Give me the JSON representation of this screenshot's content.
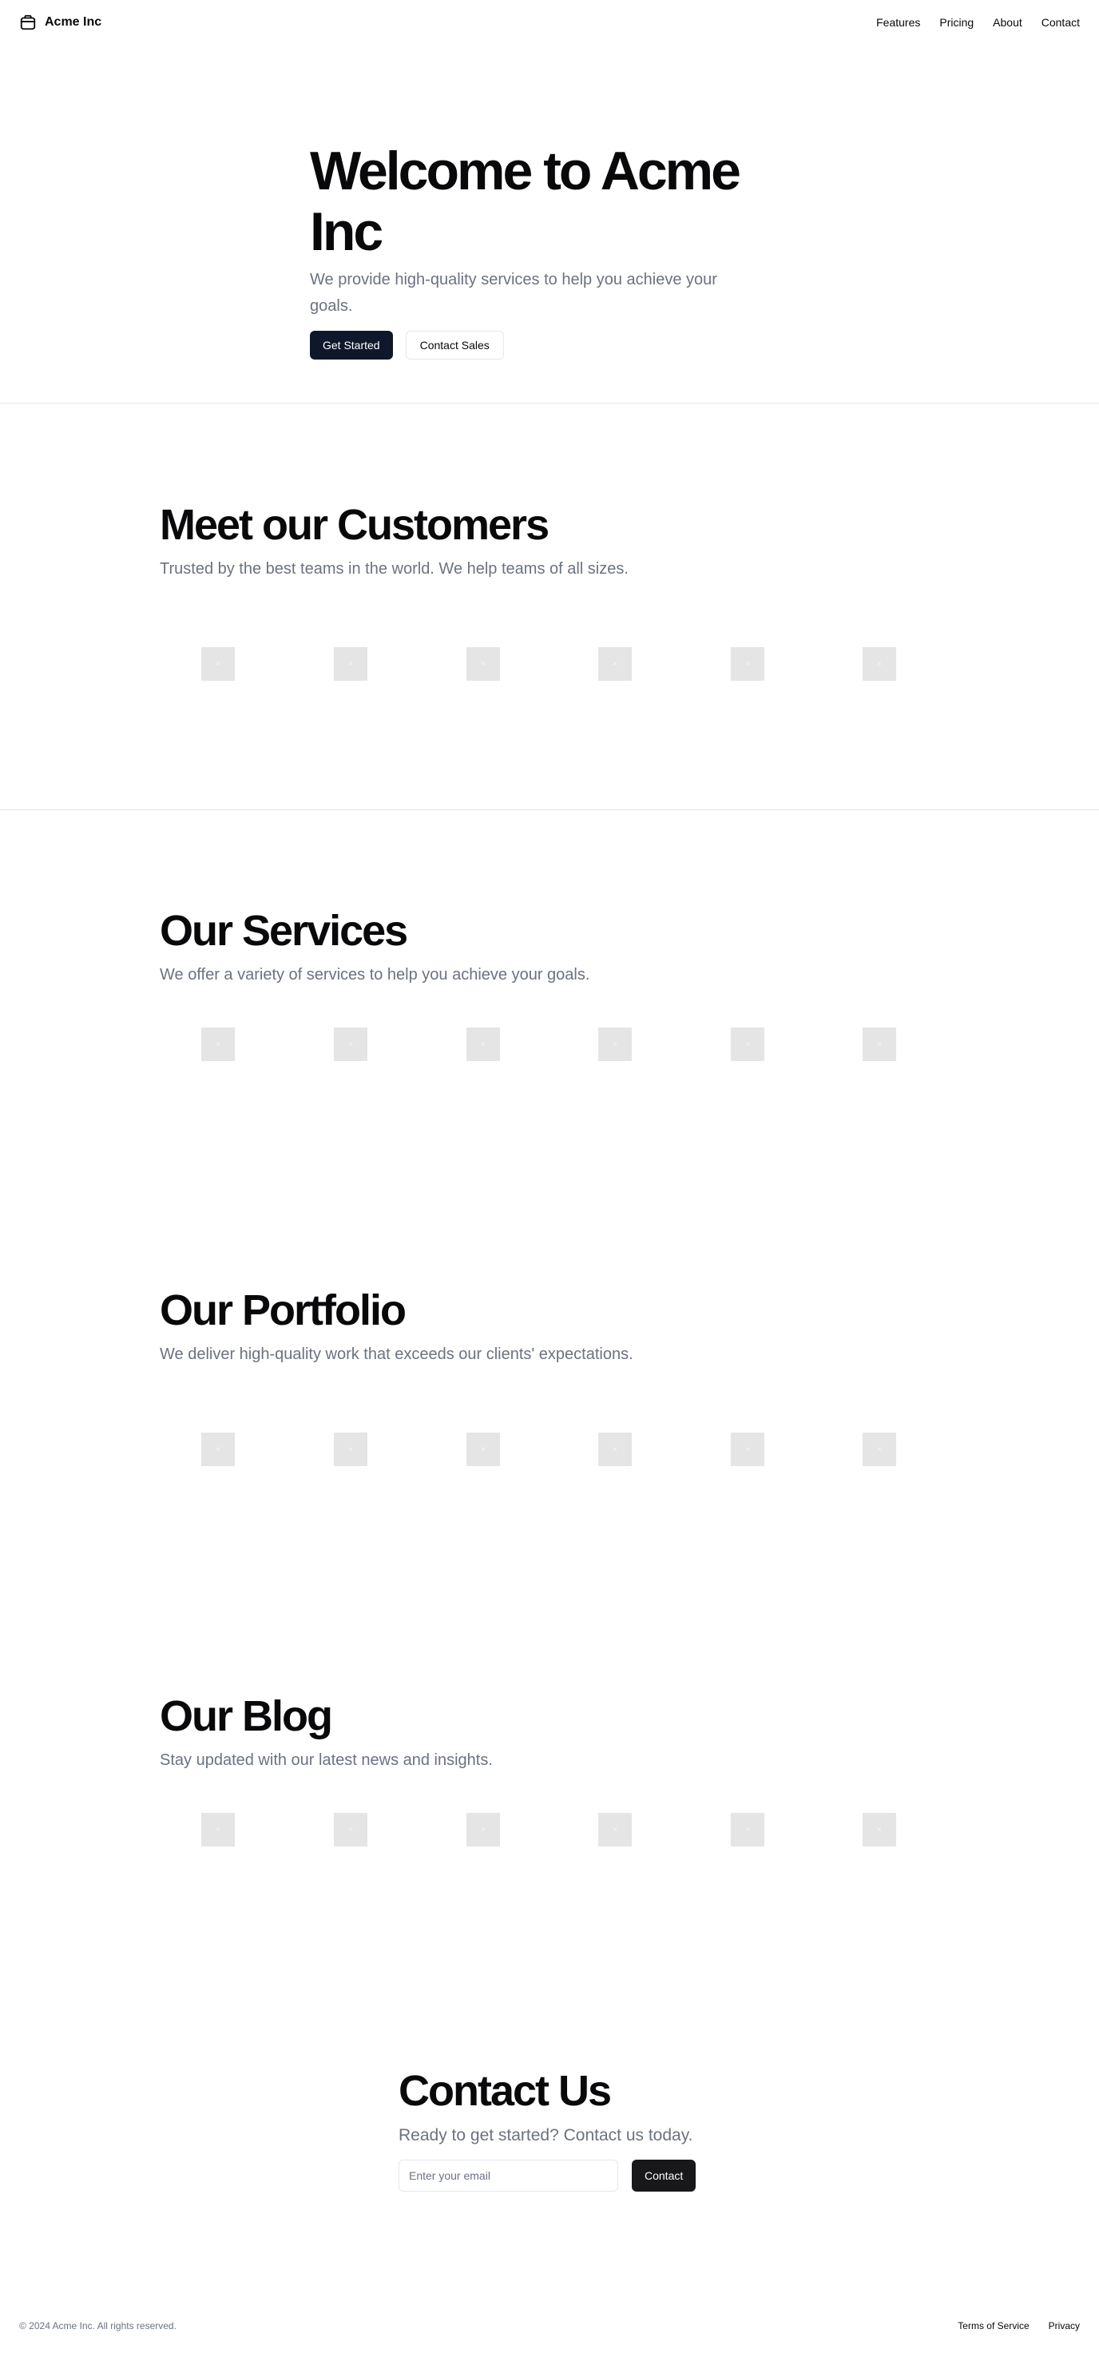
{
  "header": {
    "brand": "Acme Inc",
    "nav": [
      "Features",
      "Pricing",
      "About",
      "Contact"
    ]
  },
  "hero": {
    "title": "Welcome to Acme Inc",
    "subtitle": "We provide high-quality services to help you achieve your goals.",
    "primary_button": "Get Started",
    "secondary_button": "Contact Sales"
  },
  "sections": [
    {
      "title": "Meet our Customers",
      "subtitle": "Trusted by the best teams in the world. We help teams of all sizes."
    },
    {
      "title": "Our Services",
      "subtitle": "We offer a variety of services to help you achieve your goals."
    },
    {
      "title": "Our Portfolio",
      "subtitle": "We deliver high-quality work that exceeds our clients' expectations."
    },
    {
      "title": "Our Blog",
      "subtitle": "Stay updated with our latest news and insights."
    }
  ],
  "placeholder_glyph": "×",
  "contact": {
    "title": "Contact Us",
    "subtitle": "Ready to get started? Contact us today.",
    "email_placeholder": "Enter your email",
    "button": "Contact"
  },
  "footer": {
    "copyright": "© 2024 Acme Inc. All rights reserved.",
    "links": [
      "Terms of Service",
      "Privacy"
    ]
  },
  "colors": {
    "primary_button": "#0f172a",
    "contact_button": "#18181b",
    "muted_text": "#6b7280",
    "placeholder_box": "#e5e5e5",
    "border": "#e5e7eb"
  }
}
